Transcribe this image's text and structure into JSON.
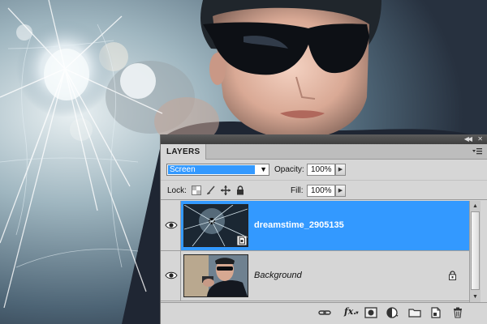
{
  "panel": {
    "tab_label": "LAYERS",
    "blend_mode": "Screen",
    "opacity_label": "Opacity:",
    "opacity_value": "100%",
    "lock_label": "Lock:",
    "fill_label": "Fill:",
    "fill_value": "100%"
  },
  "layers": [
    {
      "name": "dreamstime_2905135",
      "selected": true,
      "visible": true,
      "thumb": "shattered-glass"
    },
    {
      "name": "Background",
      "selected": false,
      "visible": true,
      "locked": true,
      "thumb": "man-with-gun"
    }
  ],
  "bottom_bar": {
    "fx_label": "fx.",
    "icons": [
      "link-icon",
      "fx-icon",
      "mask-icon",
      "adjustment-icon",
      "folder-icon",
      "new-layer-icon",
      "trash-icon"
    ]
  },
  "colors": {
    "selection": "#3399ff",
    "panel_bg": "#d6d6d6",
    "titlebar": "#4a4a4a"
  }
}
